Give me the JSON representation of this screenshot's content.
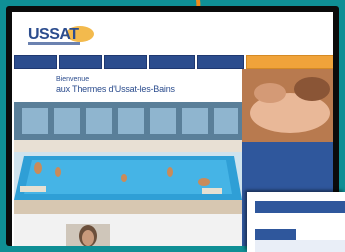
{
  "header": {
    "logo_text": "USSAT",
    "logo_tagline": ""
  },
  "nav": {
    "items": [
      {
        "label": ""
      },
      {
        "label": ""
      },
      {
        "label": ""
      },
      {
        "label": ""
      },
      {
        "label": ""
      }
    ],
    "highlight_label": ""
  },
  "welcome": {
    "line1": "Bienvenue",
    "line2": "aux Thermes d'Ussat-les-Bains",
    "line3": ""
  },
  "sidebar": {
    "link1": "",
    "link2": ""
  },
  "overlay_window": {
    "title": "",
    "tab_label": ""
  },
  "colors": {
    "primary": "#2c4d8e",
    "accent": "#f0a33a",
    "frame": "#0f8f95"
  }
}
